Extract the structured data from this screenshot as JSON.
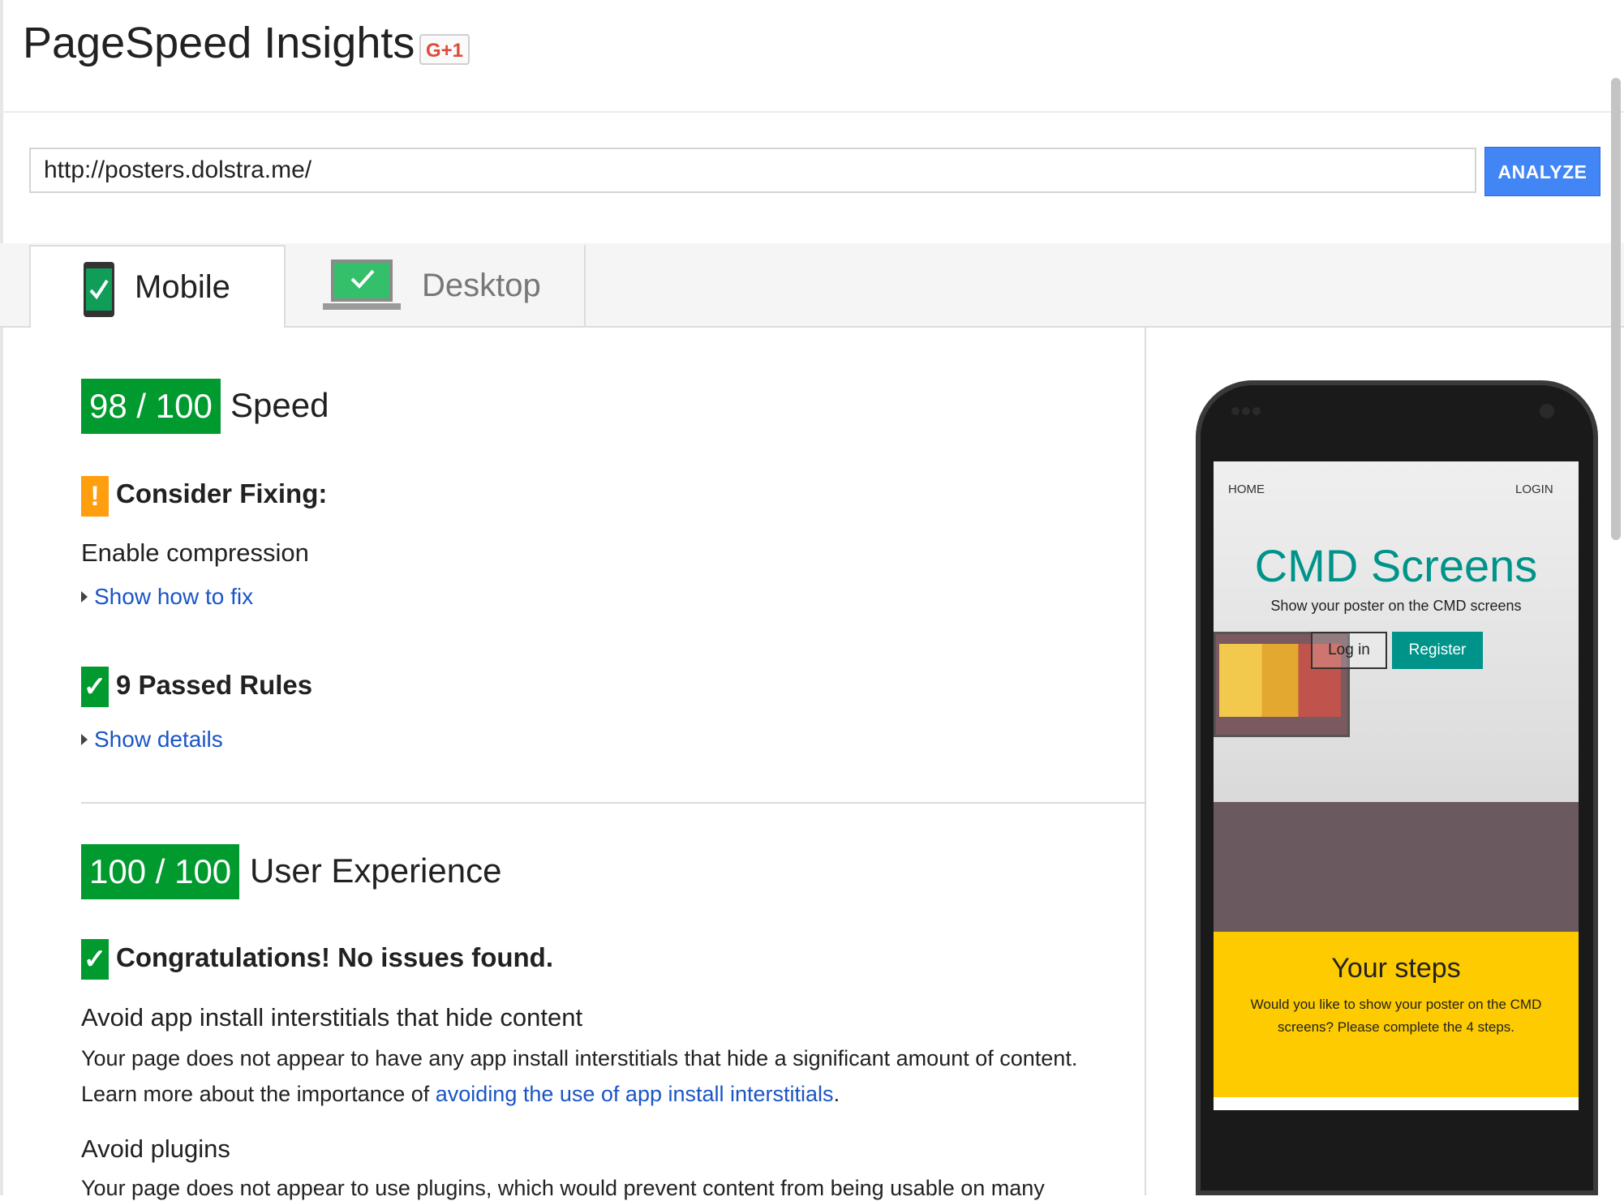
{
  "header": {
    "title": "PageSpeed Insights",
    "gplus_label": "G+1"
  },
  "url_bar": {
    "value": "http://posters.dolstra.me/",
    "analyze_label": "ANALYZE"
  },
  "tabs": [
    {
      "label": "Mobile",
      "icon": "mobile-phone-check-icon",
      "active": true
    },
    {
      "label": "Desktop",
      "icon": "laptop-check-icon",
      "active": false
    }
  ],
  "speed": {
    "score": "98 / 100",
    "title": "Speed",
    "consider_heading": "Consider Fixing:",
    "consider_icon": "!",
    "fix_rule": "Enable compression",
    "show_fix_link": "Show how to fix",
    "passed_heading": "9 Passed Rules",
    "passed_icon": "✓",
    "show_details_link": "Show details"
  },
  "user_experience": {
    "score": "100 / 100",
    "title": "User Experience",
    "congrats_icon": "✓",
    "congrats_heading": "Congratulations! No issues found.",
    "rules": [
      {
        "name": "Avoid app install interstitials that hide content",
        "body": "Your page does not appear to have any app install interstitials that hide a significant amount of content.",
        "learn_prefix": "Learn more about the importance of ",
        "learn_link": "avoiding the use of app install interstitials",
        "learn_suffix": "."
      },
      {
        "name": "Avoid plugins",
        "body": "Your page does not appear to use plugins, which would prevent content from being usable on many"
      }
    ]
  },
  "preview": {
    "nav_home": "HOME",
    "nav_login": "LOGIN",
    "title": "CMD Screens",
    "subtitle": "Show your poster on the CMD screens",
    "login_button": "Log in",
    "register_button": "Register",
    "steps_title": "Your steps",
    "steps_text": "Would you like to show your poster on the CMD screens? Please complete the 4 steps."
  },
  "colors": {
    "score_green": "#009a2e",
    "warning_orange": "#ff9e0f",
    "analyze_blue": "#4285f4",
    "link_blue": "#1a55c7",
    "preview_teal": "#00938a",
    "preview_yellow": "#fdcb00"
  }
}
